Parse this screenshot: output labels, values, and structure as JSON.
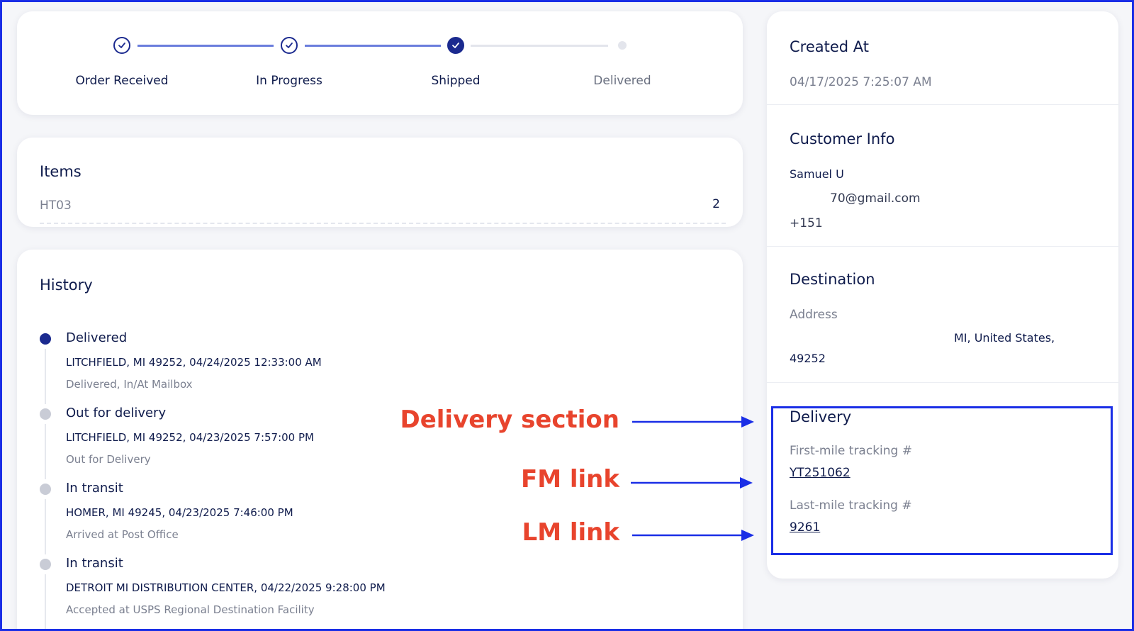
{
  "stepper": {
    "steps": [
      {
        "label": "Order Received",
        "state": "completed"
      },
      {
        "label": "In Progress",
        "state": "completed"
      },
      {
        "label": "Shipped",
        "state": "current"
      },
      {
        "label": "Delivered",
        "state": "pending"
      }
    ]
  },
  "items": {
    "title": "Items",
    "rows": [
      {
        "sku": "HT03",
        "qty": "2"
      }
    ]
  },
  "history": {
    "title": "History",
    "entries": [
      {
        "status": "Delivered",
        "location": "LITCHFIELD, MI 49252, 04/24/2025 12:33:00 AM",
        "description": "Delivered, In/At Mailbox",
        "active": true
      },
      {
        "status": "Out for delivery",
        "location": "LITCHFIELD, MI 49252, 04/23/2025 7:57:00 PM",
        "description": "Out for Delivery",
        "active": false
      },
      {
        "status": "In transit",
        "location": "HOMER, MI 49245, 04/23/2025 7:46:00 PM",
        "description": "Arrived at Post Office",
        "active": false
      },
      {
        "status": "In transit",
        "location": "DETROIT MI DISTRIBUTION CENTER, 04/22/2025 9:28:00 PM",
        "description": "Accepted at USPS Regional Destination Facility",
        "active": false
      }
    ]
  },
  "created": {
    "title": "Created At",
    "value": "04/17/2025 7:25:07 AM"
  },
  "customer": {
    "title": "Customer Info",
    "name": "Samuel U",
    "email": "70@gmail.com",
    "phone": "+151"
  },
  "destination": {
    "title": "Destination",
    "address_label": "Address",
    "address_line": "MI, United States,",
    "zip": "49252"
  },
  "delivery": {
    "title": "Delivery",
    "fm_label": "First-mile tracking #",
    "fm_value": "YT251062",
    "lm_label": "Last-mile tracking #",
    "lm_value": "9261"
  },
  "annotations": {
    "delivery_section": "Delivery section",
    "fm_link": "FM link",
    "lm_link": "LM link"
  },
  "colors": {
    "accent": "#1b2a8f",
    "annotation": "#e8442d",
    "highlight": "#1a2ee6"
  }
}
